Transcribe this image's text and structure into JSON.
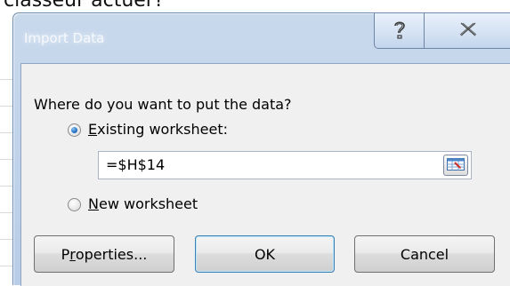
{
  "page_text": "ciasseur actuer?",
  "dialog": {
    "title": "Import Data",
    "help_icon": "help-question-icon",
    "close_icon": "close-x-icon",
    "prompt": "Where do you want to put the data?",
    "existing_worksheet": {
      "mnemonic": "E",
      "label_rest": "xisting worksheet:",
      "selected": true
    },
    "reference_value": "=$H$14",
    "collapse_icon": "range-select-icon",
    "new_worksheet": {
      "mnemonic": "N",
      "label_rest": "ew worksheet",
      "selected": false
    },
    "buttons": {
      "properties_pre": "P",
      "properties_mnemonic": "r",
      "properties_post": "operties...",
      "ok": "OK",
      "cancel": "Cancel"
    }
  }
}
